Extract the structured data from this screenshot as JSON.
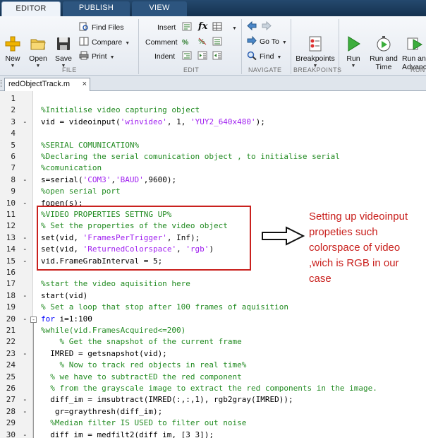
{
  "tabs": [
    {
      "label": "EDITOR"
    },
    {
      "label": "PUBLISH"
    },
    {
      "label": "VIEW"
    }
  ],
  "toolstrip": {
    "file": {
      "section_label": "FILE",
      "new": "New",
      "open": "Open",
      "save": "Save",
      "find_files": "Find Files",
      "compare": "Compare",
      "print": "Print"
    },
    "edit": {
      "section_label": "EDIT",
      "insert": "Insert",
      "comment": "Comment",
      "indent": "Indent",
      "fx": "fx"
    },
    "navigate": {
      "section_label": "NAVIGATE",
      "go_to": "Go To",
      "find": "Find"
    },
    "breakpoints": {
      "section_label": "BREAKPOINTS",
      "breakpoints": "Breakpoints"
    },
    "run": {
      "section_label": "RUN",
      "run": "Run",
      "run_and_time": "Run and Time",
      "run_and_advance": "Run and Advance"
    }
  },
  "document": {
    "filename": "redObjectTrack.m",
    "close": "×"
  },
  "editor": {
    "lines": [
      {
        "n": "1",
        "bp": false,
        "tokens": []
      },
      {
        "n": "2",
        "bp": false,
        "tokens": [
          {
            "t": "cm",
            "v": "%Initialise video capturing object"
          }
        ]
      },
      {
        "n": "3",
        "bp": true,
        "tokens": [
          {
            "t": "pl",
            "v": "vid = videoinput("
          },
          {
            "t": "str",
            "v": "'winvideo'"
          },
          {
            "t": "pl",
            "v": ", 1, "
          },
          {
            "t": "str",
            "v": "'YUY2_640x480'"
          },
          {
            "t": "pl",
            "v": ");"
          }
        ]
      },
      {
        "n": "4",
        "bp": false,
        "tokens": []
      },
      {
        "n": "5",
        "bp": false,
        "tokens": [
          {
            "t": "cm",
            "v": "%SERIAL COMUNICATION%"
          }
        ]
      },
      {
        "n": "6",
        "bp": false,
        "tokens": [
          {
            "t": "cm",
            "v": "%Declaring the serial comunication object , to initialise serial"
          }
        ]
      },
      {
        "n": "7",
        "bp": false,
        "tokens": [
          {
            "t": "cm",
            "v": "%comunication"
          }
        ]
      },
      {
        "n": "8",
        "bp": true,
        "tokens": [
          {
            "t": "pl",
            "v": "s=serial("
          },
          {
            "t": "str",
            "v": "'COM3'"
          },
          {
            "t": "pl",
            "v": ","
          },
          {
            "t": "str",
            "v": "'BAUD'"
          },
          {
            "t": "pl",
            "v": ",9600);"
          }
        ]
      },
      {
        "n": "9",
        "bp": false,
        "tokens": [
          {
            "t": "cm",
            "v": "%open serial port"
          }
        ]
      },
      {
        "n": "10",
        "bp": true,
        "tokens": [
          {
            "t": "pl",
            "v": "fopen(s);"
          }
        ]
      },
      {
        "n": "11",
        "bp": false,
        "tokens": [
          {
            "t": "cm",
            "v": "%VIDEO PROPERTIES SETTNG UP%"
          }
        ]
      },
      {
        "n": "12",
        "bp": false,
        "tokens": [
          {
            "t": "cm",
            "v": "% Set the properties of the video object"
          }
        ]
      },
      {
        "n": "13",
        "bp": true,
        "tokens": [
          {
            "t": "pl",
            "v": "set(vid, "
          },
          {
            "t": "str",
            "v": "'FramesPerTrigger'"
          },
          {
            "t": "pl",
            "v": ", Inf);"
          }
        ]
      },
      {
        "n": "14",
        "bp": true,
        "tokens": [
          {
            "t": "pl",
            "v": "set(vid, "
          },
          {
            "t": "str",
            "v": "'ReturnedColorspace'"
          },
          {
            "t": "pl",
            "v": ", "
          },
          {
            "t": "str",
            "v": "'rgb'"
          },
          {
            "t": "pl",
            "v": ")"
          }
        ]
      },
      {
        "n": "15",
        "bp": true,
        "tokens": [
          {
            "t": "pl",
            "v": "vid.FrameGrabInterval = 5;"
          }
        ]
      },
      {
        "n": "16",
        "bp": false,
        "tokens": []
      },
      {
        "n": "17",
        "bp": false,
        "tokens": [
          {
            "t": "cm",
            "v": "%start the video aquisition here"
          }
        ]
      },
      {
        "n": "18",
        "bp": true,
        "tokens": [
          {
            "t": "pl",
            "v": "start(vid)"
          }
        ]
      },
      {
        "n": "19",
        "bp": false,
        "tokens": [
          {
            "t": "cm",
            "v": "% Set a loop that stop after 100 frames of aquisition"
          }
        ]
      },
      {
        "n": "20",
        "bp": true,
        "fold": true,
        "tokens": [
          {
            "t": "kw",
            "v": "for"
          },
          {
            "t": "pl",
            "v": " i=1:100"
          }
        ]
      },
      {
        "n": "21",
        "bp": false,
        "tokens": [
          {
            "t": "cm",
            "v": "%while(vid.FramesAcquired<=200)"
          }
        ]
      },
      {
        "n": "22",
        "bp": false,
        "tokens": [
          {
            "t": "cm",
            "v": "    % Get the snapshot of the current frame"
          }
        ]
      },
      {
        "n": "23",
        "bp": true,
        "tokens": [
          {
            "t": "pl",
            "v": "  IMRED = getsnapshot(vid);"
          }
        ]
      },
      {
        "n": "24",
        "bp": false,
        "tokens": [
          {
            "t": "cm",
            "v": "    % Now to track red objects in real time%"
          }
        ]
      },
      {
        "n": "25",
        "bp": false,
        "tokens": [
          {
            "t": "cm",
            "v": "  % we have to subtractED the red component"
          }
        ]
      },
      {
        "n": "26",
        "bp": false,
        "tokens": [
          {
            "t": "cm",
            "v": "  % from the grayscale image to extract the red components in the image."
          }
        ]
      },
      {
        "n": "27",
        "bp": true,
        "tokens": [
          {
            "t": "pl",
            "v": "  diff_im = imsubtract(IMRED(:,:,1), rgb2gray(IMRED));"
          }
        ]
      },
      {
        "n": "28",
        "bp": true,
        "tokens": [
          {
            "t": "pl",
            "v": "   gr=graythresh(diff_im);"
          }
        ]
      },
      {
        "n": "29",
        "bp": false,
        "tokens": [
          {
            "t": "cm",
            "v": "  %Median filter IS USED to filter out noise"
          }
        ]
      },
      {
        "n": "30",
        "bp": true,
        "tokens": [
          {
            "t": "pl",
            "v": "  diff_im = medfilt2(diff_im, [3 3]);"
          }
        ]
      }
    ]
  },
  "annotation": {
    "text": "Setting up videoinput propeties such colorspace of video ,wich is RGB in our case"
  },
  "colors": {
    "comment": "#228B22",
    "string": "#A020F0",
    "keyword": "#0000FF",
    "annotation": "#C9211E",
    "tabstrip": "#1E3F62"
  }
}
